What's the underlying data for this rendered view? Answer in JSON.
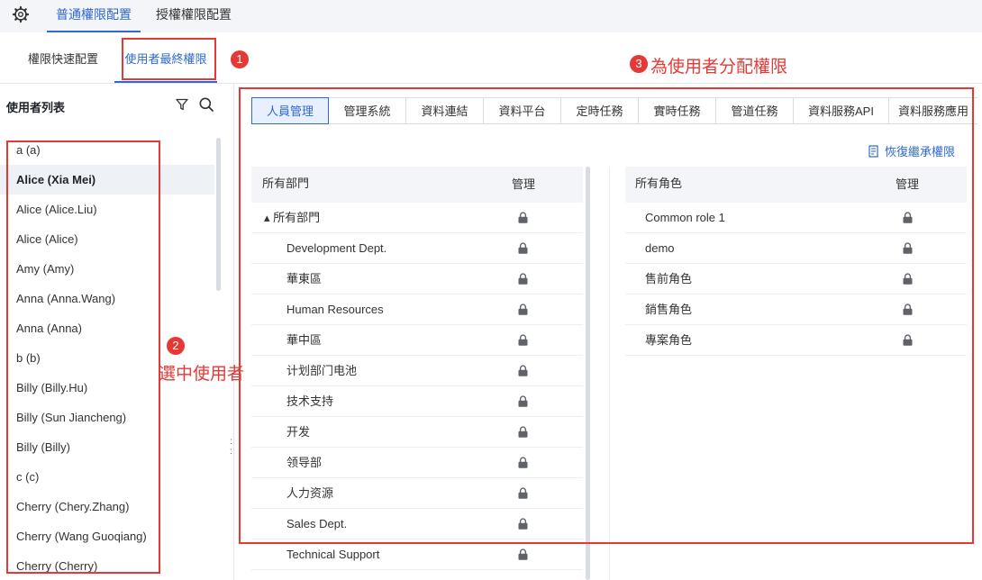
{
  "top_tabs": [
    "普通權限配置",
    "授權權限配置"
  ],
  "sub_tabs": [
    "權限快速配置",
    "使用者最終權限"
  ],
  "user_panel": {
    "title": "使用者列表",
    "users": [
      "a (a)",
      "Alice (Xia Mei)",
      "Alice (Alice.Liu)",
      "Alice (Alice)",
      "Amy (Amy)",
      "Anna (Anna.Wang)",
      "Anna (Anna)",
      "b (b)",
      "Billy (Billy.Hu)",
      "Billy (Sun Jiancheng)",
      "Billy (Billy)",
      "c (c)",
      "Cherry (Chery.Zhang)",
      "Cherry (Wang Guoqiang)",
      "Cherry (Cherry)"
    ],
    "selected_user": "Alice (Xia Mei)"
  },
  "module_tabs": [
    "人員管理",
    "管理系統",
    "資料連結",
    "資料平台",
    "定時任務",
    "實時任務",
    "管道任務",
    "資料服務API",
    "資料服務應用"
  ],
  "active_module_tab": "人員管理",
  "restore_label": "恢復繼承權限",
  "dept_table": {
    "col_name": "所有部門",
    "col_manage": "管理",
    "rows": [
      "▴ 所有部門",
      "Development Dept.",
      "華東區",
      "Human Resources",
      "華中區",
      "计划部门电池",
      "技术支持",
      "开发",
      "领导部",
      "人力资源",
      "Sales Dept.",
      "Technical Support"
    ]
  },
  "role_table": {
    "col_name": "所有角色",
    "col_manage": "管理",
    "rows": [
      "Common role 1",
      "demo",
      "售前角色",
      "銷售角色",
      "專案角色"
    ]
  },
  "annotations": {
    "badge1": "1",
    "badge2": "2",
    "badge3": "3",
    "text2": "選中使用者",
    "text3": "為使用者分配權限"
  },
  "colors": {
    "accent": "#2f68d1",
    "annotation": "#e53935"
  },
  "icons": [
    "gear-icon",
    "filter-icon",
    "search-icon",
    "lock-icon",
    "restore-icon"
  ]
}
